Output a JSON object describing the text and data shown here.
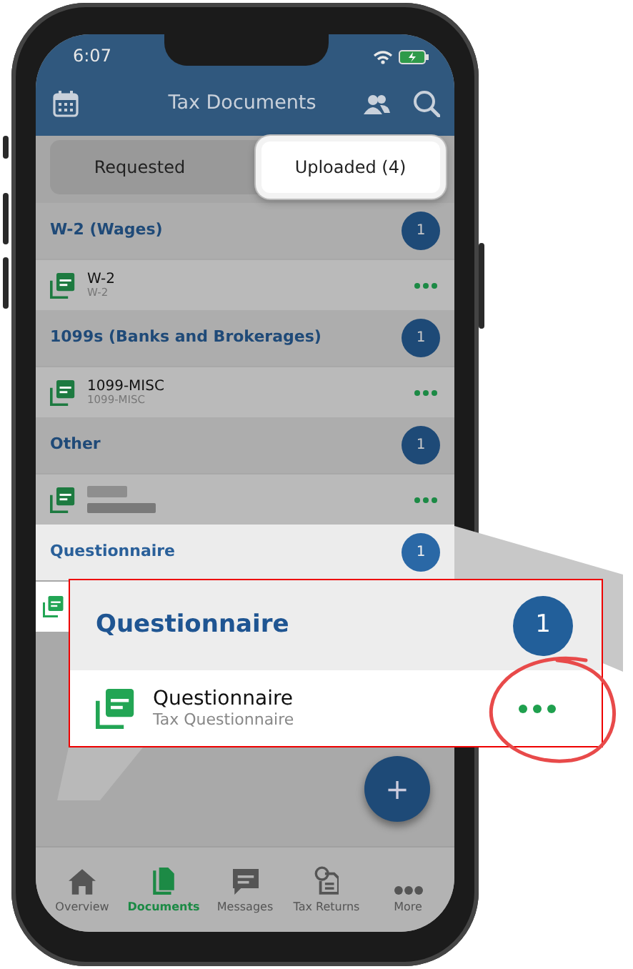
{
  "status_bar": {
    "time": "6:07"
  },
  "header": {
    "title": "Tax Documents"
  },
  "tabs": [
    {
      "label": "Requested",
      "selected": false
    },
    {
      "label": "Uploaded (4)",
      "selected": true
    }
  ],
  "sections": [
    {
      "title": "W-2 (Wages)",
      "count": "1",
      "highlighted": false,
      "docs": [
        {
          "kind": "file",
          "name": "W-2",
          "subtitle": "W-2"
        }
      ]
    },
    {
      "title": "1099s (Banks and Brokerages)",
      "count": "1",
      "highlighted": false,
      "docs": [
        {
          "kind": "file",
          "name": "1099-MISC",
          "subtitle": "1099-MISC"
        }
      ]
    },
    {
      "title": "Other",
      "count": "1",
      "highlighted": false,
      "docs": [
        {
          "kind": "redacted"
        }
      ]
    },
    {
      "title": "Questionnaire",
      "count": "1",
      "highlighted": true,
      "docs": [
        {
          "kind": "covered"
        }
      ]
    }
  ],
  "fab": {
    "label": "+"
  },
  "tab_bar": [
    {
      "label": "Overview",
      "kind": "home",
      "selected": false
    },
    {
      "label": "Documents",
      "kind": "docs",
      "selected": true
    },
    {
      "label": "Messages",
      "kind": "chat",
      "selected": false
    },
    {
      "label": "Tax Returns",
      "kind": "returns",
      "selected": false
    },
    {
      "label": "More",
      "kind": "more",
      "selected": false
    }
  ],
  "callout": {
    "title": "Questionnaire",
    "count": "1",
    "doc": {
      "name": "Questionnaire",
      "subtitle": "Tax Questionnaire"
    }
  }
}
